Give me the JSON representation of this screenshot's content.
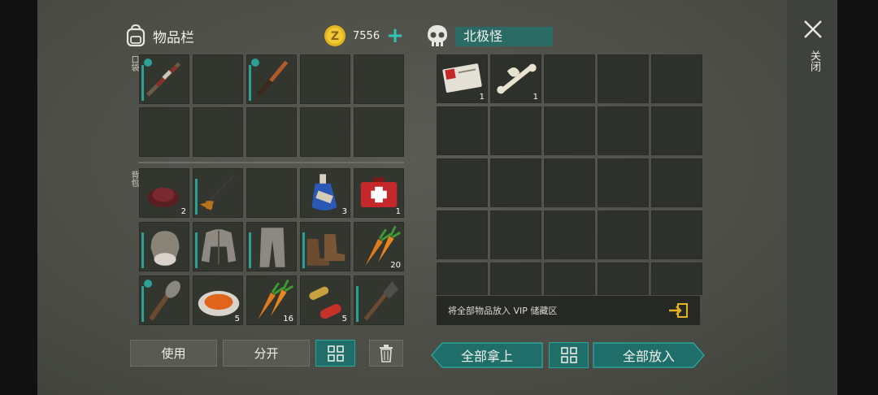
{
  "inventory": {
    "title": "物品栏",
    "coins": "7556",
    "pockets_label": "口袋",
    "backpack_label": "背包",
    "pockets": [
      {
        "icon": "rifle-icon",
        "badge": true,
        "dur": true,
        "count": ""
      },
      {
        "icon": "",
        "count": ""
      },
      {
        "icon": "knife-icon",
        "badge": true,
        "dur": true,
        "count": ""
      },
      {
        "icon": "",
        "count": ""
      },
      {
        "icon": "",
        "count": ""
      },
      {
        "icon": "",
        "count": ""
      },
      {
        "icon": "",
        "count": ""
      },
      {
        "icon": "",
        "count": ""
      },
      {
        "icon": "",
        "count": ""
      },
      {
        "icon": "",
        "count": ""
      }
    ],
    "backpack": [
      {
        "icon": "berries-icon",
        "count": "2"
      },
      {
        "icon": "crossbow-icon",
        "dur": true,
        "count": ""
      },
      {
        "icon": "",
        "count": ""
      },
      {
        "icon": "bottle-icon",
        "count": "3"
      },
      {
        "icon": "first-aid-kit-icon",
        "count": "1"
      },
      {
        "icon": "hat-icon",
        "dur": true,
        "count": ""
      },
      {
        "icon": "jacket-icon",
        "dur": true,
        "count": ""
      },
      {
        "icon": "pants-icon",
        "dur": true,
        "count": ""
      },
      {
        "icon": "boots-icon",
        "dur": true,
        "count": ""
      },
      {
        "icon": "carrots-icon",
        "count": "20"
      },
      {
        "icon": "club-icon",
        "badge": true,
        "dur": true,
        "count": ""
      },
      {
        "icon": "stew-plate-icon",
        "count": "5"
      },
      {
        "icon": "carrots-icon",
        "count": "16"
      },
      {
        "icon": "pills-icon",
        "count": "5"
      },
      {
        "icon": "shovel-icon",
        "dur": true,
        "count": ""
      }
    ],
    "buttons": {
      "use": "使用",
      "split": "分开"
    }
  },
  "loot": {
    "name": "北极怪",
    "items": [
      {
        "icon": "army-card-icon",
        "count": "1"
      },
      {
        "icon": "bone-icon",
        "count": "1"
      }
    ],
    "vip_text": "将全部物品放入 VIP 储藏区",
    "take_all": "全部拿上",
    "put_all": "全部放入"
  },
  "close_label": "关闭",
  "colors": {
    "accent": "#2aa096",
    "coin": "#e3b21f"
  }
}
